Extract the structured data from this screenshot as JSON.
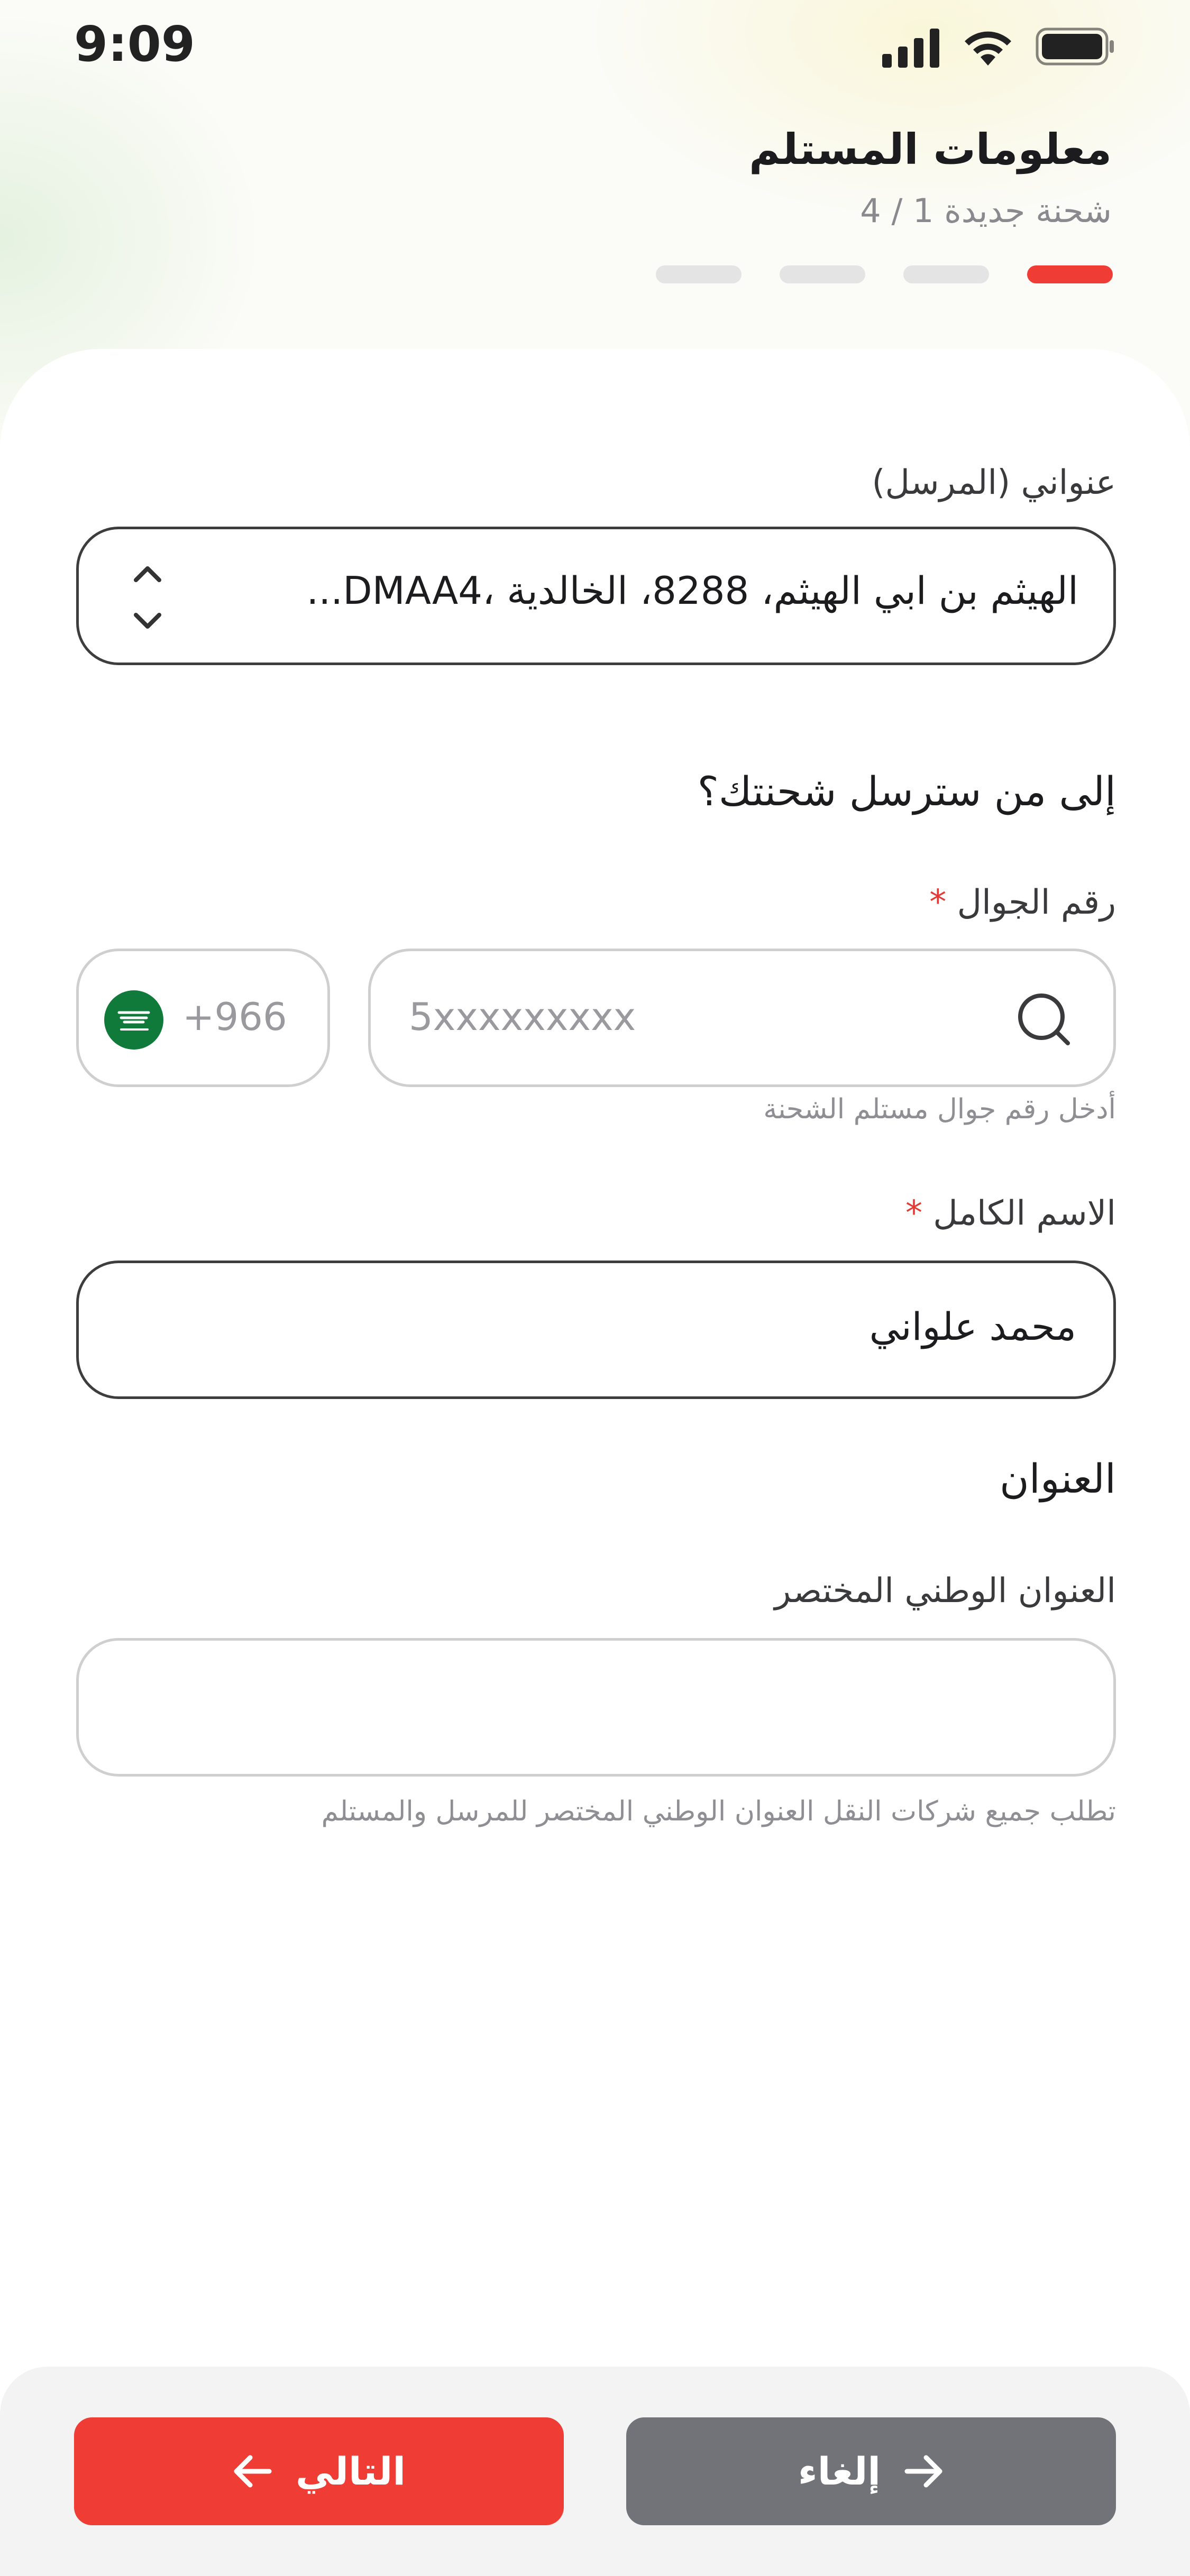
{
  "status_bar": {
    "time": "9:09"
  },
  "header": {
    "title": "معلومات المستلم",
    "subtitle": "شحنة جديدة 1 / 4",
    "steps": 4,
    "active_step": 1
  },
  "sender": {
    "label": "عنواني (المرسل)",
    "value": "الهيثم بن ابي الهيثم، 8288، الخالدية ،DMAA4..."
  },
  "recipient": {
    "heading": "إلى من سترسل شحنتك؟",
    "phone_label": "رقم الجوال",
    "required_mark": "*",
    "country_code": "+966",
    "phone_placeholder": "5xxxxxxxxx",
    "phone_hint": "أدخل رقم جوال مستلم الشحنة",
    "name_label": "الاسم الكامل",
    "name_value": "محمد علواني"
  },
  "address": {
    "heading": "العنوان",
    "short_label": "العنوان الوطني المختصر",
    "short_value": "",
    "hint": "تطلب جميع شركات النقل العنوان الوطني المختصر للمرسل والمستلم"
  },
  "footer": {
    "next_label": "التالي",
    "cancel_label": "إلغاء"
  },
  "colors": {
    "accent": "#ef3c35",
    "cancel": "#727279",
    "flag_green": "#0f7a3a"
  },
  "icons": [
    "signal-icon",
    "wifi-icon",
    "battery-icon",
    "sort-chevrons-icon",
    "search-icon",
    "saudi-flag-icon",
    "arrow-left-icon",
    "arrow-right-icon"
  ]
}
